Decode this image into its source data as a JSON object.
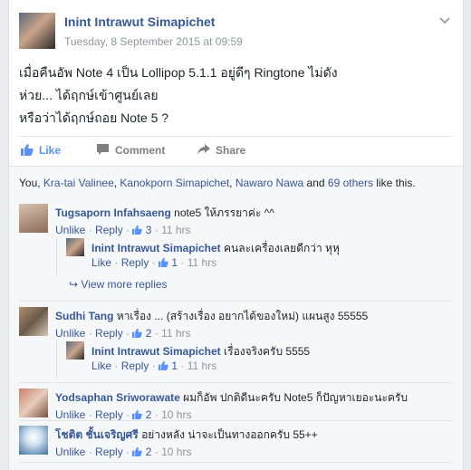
{
  "post": {
    "author": "Inint Intrawut Simapichet",
    "timestamp": "Tuesday, 8 September 2015 at 09:59",
    "lines": [
      "เมื่อคืนอัพ Note 4 เป็น Lollipop 5.1.1 อยู่ดีๆ Ringtone ไม่ดัง",
      "ห่วย... ได้ฤกษ์เข้าศูนย์เลย",
      "หรือว่าได้ฤกษ์ถอย Note 5 ?"
    ]
  },
  "actions": {
    "like": "Like",
    "comment": "Comment",
    "share": "Share"
  },
  "likes": {
    "prefix": "You, ",
    "name1": "Kra-tai Valinee",
    "sep1": ", ",
    "name2": "Kanokporn Simapichet",
    "sep2": ", ",
    "name3": "Nawaro Nawa",
    "and": " and ",
    "others": "69 others",
    "suffix": " like this."
  },
  "comments": [
    {
      "name": "Tugsaporn Infahsaeng",
      "text": "note5 ให้ภรรยาค่ะ ^^",
      "unlike": "Unlike",
      "reply": "Reply",
      "count": "3",
      "time": "11 hrs"
    },
    {
      "name": "Inint Intrawut Simapichet",
      "text": "คนละเครื่องเลยดีกว่า หุหุ",
      "unlike": "Like",
      "reply": "Reply",
      "count": "1",
      "time": "11 hrs"
    },
    {
      "name": "Sudhi Tang",
      "text": "หาเรื่อง ... (สร้างเรื่อง อยากได้ของใหม่) แผนสูง 55555",
      "unlike": "Unlike",
      "reply": "Reply",
      "count": "2",
      "time": "11 hrs"
    },
    {
      "name": "Inint Intrawut Simapichet",
      "text": "เรื่องจริงครับ 5555",
      "unlike": "Like",
      "reply": "Reply",
      "count": "1",
      "time": "11 hrs"
    },
    {
      "name": "Yodsaphan Sriworawate",
      "text": "ผมก็อัพ ปกติดีนะครับ Note5 ก็ปัญหาเยอะนะครับ",
      "unlike": "Unlike",
      "reply": "Reply",
      "count": "2",
      "time": "10 hrs"
    },
    {
      "name": "โชติต ชั้นเจริญศรี",
      "text": "อย่างหลัง น่าจะเป็นทางออกครับ 55++",
      "unlike": "Unlike",
      "reply": "Reply",
      "count": "2",
      "time": "10 hrs"
    }
  ],
  "view_more": "View more replies",
  "colors": {
    "link": "#365899",
    "meta": "#90949c",
    "bg": "#f6f7f9"
  }
}
